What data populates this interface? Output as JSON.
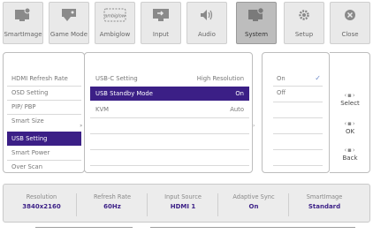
{
  "toolbar": [
    {
      "label": "SmartImage",
      "icon": "smartimage-icon"
    },
    {
      "label": "Game Mode",
      "icon": "gamepad-icon"
    },
    {
      "label": "Ambiglow",
      "icon": "ambiglow-icon",
      "icon_text": "ambiglow"
    },
    {
      "label": "Input",
      "icon": "input-icon"
    },
    {
      "label": "Audio",
      "icon": "speaker-icon"
    },
    {
      "label": "System",
      "icon": "system-icon"
    },
    {
      "label": "Setup",
      "icon": "gear-icon"
    },
    {
      "label": "Close",
      "icon": "close-icon"
    }
  ],
  "menu_level1": [
    "HDMI Refresh Rate",
    "OSD Setting",
    "PIP/ PBP",
    "Smart Size",
    "USB Setting",
    "Smart Power",
    "Over Scan"
  ],
  "menu_level2": [
    {
      "label": "USB-C Setting",
      "value": "High Resolution"
    },
    {
      "label": "USB Standby Mode",
      "value": "On"
    },
    {
      "label": "KVM",
      "value": "Auto"
    }
  ],
  "menu_level3": [
    "On",
    "Off"
  ],
  "nav": {
    "select": "Select",
    "ok": "OK",
    "back": "Back"
  },
  "status": [
    {
      "label": "Resolution",
      "value": "3840x2160"
    },
    {
      "label": "Refresh Rate",
      "value": "60Hz"
    },
    {
      "label": "Input Source",
      "value": "HDMI 1"
    },
    {
      "label": "Adaptive Sync",
      "value": "On"
    },
    {
      "label": "SmartImage",
      "value": "Standard"
    }
  ],
  "colors": {
    "accent": "#3b1f86",
    "active_tab": "#bdbdbd",
    "check": "#6a88c8"
  }
}
